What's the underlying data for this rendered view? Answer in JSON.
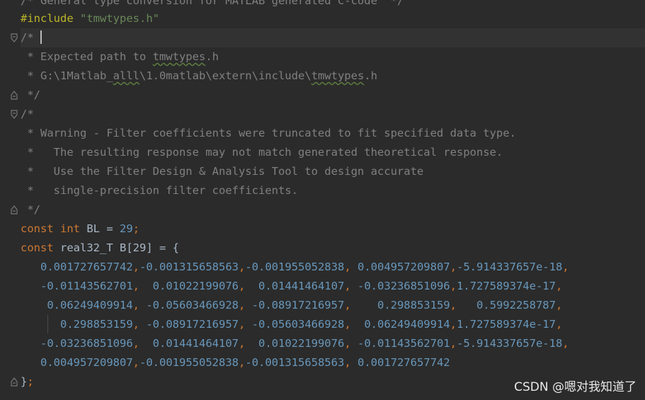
{
  "colors": {
    "background": "#2b2b2b",
    "current_line": "#323232",
    "comment": "#808080",
    "keyword": "#cc7832",
    "number": "#6897bb",
    "string": "#6a8759",
    "preprocessor": "#bbb529",
    "text": "#a9b7c6"
  },
  "code": {
    "line0": "/* General type conversion for MATLAB generated C-code  */",
    "line1": {
      "directive": "#include",
      "path": "\"tmwtypes.h\""
    },
    "line2": "/*",
    "line3": {
      "pre": " * Expected path to ",
      "typo": "tmwtypes",
      "post": ".h"
    },
    "line4": {
      "pre": " * G:\\1Matlab_",
      "typo1": "alll",
      "mid": "\\1.0matlab\\extern\\include\\",
      "typo2": "tmwtypes",
      "post": ".h"
    },
    "line5": " */",
    "line6": "/*",
    "line7": " * Warning - Filter coefficients were truncated to fit specified data type.",
    "line8": " *   The resulting response may not match generated theoretical response.",
    "line9": " *   Use the Filter Design & Analysis Tool to design accurate",
    "line10": " *   single-precision filter coefficients.",
    "line11": " */",
    "line12": {
      "kw1": "const",
      "kw2": "int",
      "ident": " BL = ",
      "value": "29",
      "semi": ";"
    },
    "line13": {
      "kw1": "const",
      "rest": " real32_T B[29] = {"
    },
    "coefficients": [
      [
        "0.001727657742",
        "-0.001315658563",
        "-0.001955052838",
        " 0.004957209807",
        "-5.914337657e-18"
      ],
      [
        "-0.01143562701",
        "  0.01022199076",
        "  0.01441464107",
        " -0.03236851096",
        "1.727589374e-17"
      ],
      [
        "0.06249409914",
        " -0.05603466928",
        " -0.08917216957",
        "    0.298853159",
        "   0.5992258787"
      ],
      [
        "0.298853159",
        " -0.08917216957",
        " -0.05603466928",
        "  0.06249409914",
        "1.727589374e-17"
      ],
      [
        "-0.03236851096",
        "  0.01441464107",
        "  0.01022199076",
        " -0.01143562701",
        "-5.914337657e-18"
      ],
      [
        "0.004957209807",
        "-0.001955052838",
        "-0.001315658563",
        " 0.001727657742"
      ]
    ],
    "closing": {
      "brace": "}",
      "semi": ";"
    }
  },
  "watermark": "CSDN @嗯对我知道了"
}
